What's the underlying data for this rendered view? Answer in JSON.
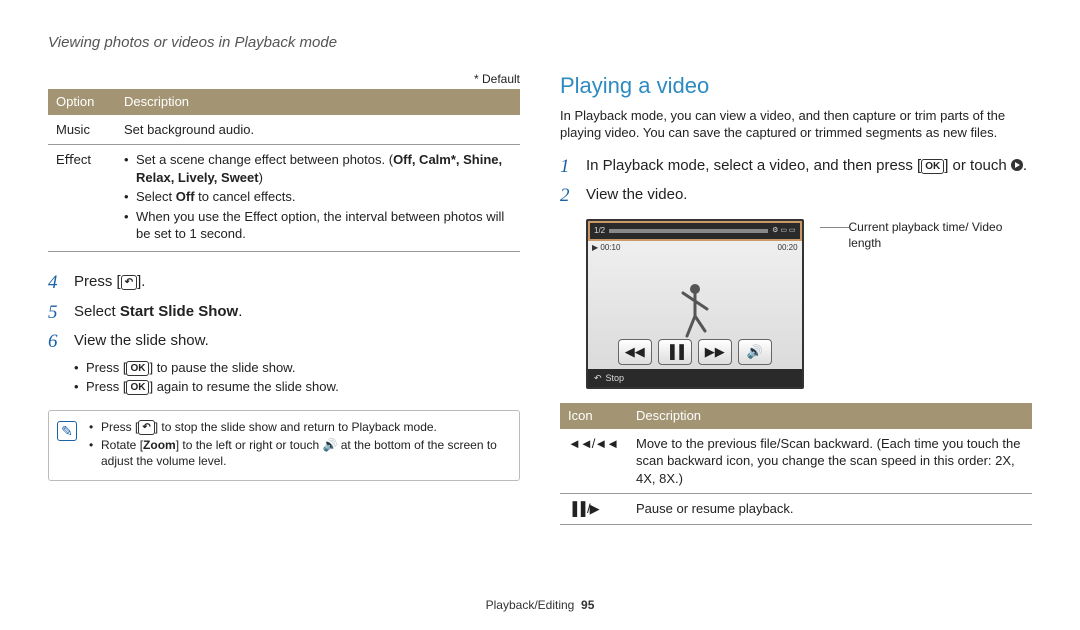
{
  "header": {
    "title": "Viewing photos or videos in Playback mode"
  },
  "left": {
    "default_note": "* Default",
    "table": {
      "col0": "Option",
      "col1": "Description",
      "rows": [
        {
          "opt": "Music",
          "desc_plain": "Set background audio."
        },
        {
          "opt": "Eﬀect",
          "b0_pre": "Set a scene change effect between photos. (",
          "b0_bold": "Off, Calm*, Shine, Relax, Lively, Sweet",
          "b0_post": ")",
          "b1_pre": "Select ",
          "b1_bold": "Off",
          "b1_post": " to cancel effects.",
          "b2": "When you use the Effect option, the interval between photos will be set to 1 second."
        }
      ]
    },
    "steps": {
      "s4": {
        "num": "4",
        "text_pre": "Press [",
        "text_post": "]."
      },
      "s5": {
        "num": "5",
        "text_pre": "Select ",
        "bold": "Start Slide Show",
        "text_post": "."
      },
      "s6": {
        "num": "6",
        "text": "View the slide show.",
        "sub1_pre": "Press [",
        "sub1_post": "] to pause the slide show.",
        "sub2_pre": "Press [",
        "sub2_post": "] again to resume the slide show."
      }
    },
    "note": {
      "b0_pre": "Press [",
      "b0_post": "] to stop the slide show and return to Playback mode.",
      "b1_pre": "Rotate [",
      "b1_bold": "Zoom",
      "b1_mid": "] to the left or right or touch ",
      "b1_post": " at the bottom of the screen to adjust the volume level."
    }
  },
  "right": {
    "title": "Playing a video",
    "intro": "In Playback mode, you can view a video, and then capture or trim parts of the playing video. You can save the captured or trimmed segments as new files.",
    "steps": {
      "s1": {
        "num": "1",
        "pre": "In Playback mode, select a video, and then press [",
        "mid": "] or touch ",
        "post": "."
      },
      "s2": {
        "num": "2",
        "text": "View the video."
      }
    },
    "diagram": {
      "top_counter": "1/2",
      "time_left": "▶ 00:10",
      "time_right": "00:20",
      "stop": "Stop",
      "callout": "Current playback time/ Video length"
    },
    "icon_table": {
      "col0": "Icon",
      "col1": "Description",
      "r0_icon": "◄◄/◄◄",
      "r0_desc": "Move to the previous file/Scan backward. (Each time you touch the scan backward icon, you change the scan speed in this order: 2X, 4X, 8X.)",
      "r1_icon": "▐▐ /▶",
      "r1_desc": "Pause or resume playback."
    }
  },
  "footer": {
    "section": "Playback/Editing",
    "page": "95"
  },
  "icons": {
    "ok": "OK",
    "back": "↶",
    "speaker": "🔊"
  }
}
